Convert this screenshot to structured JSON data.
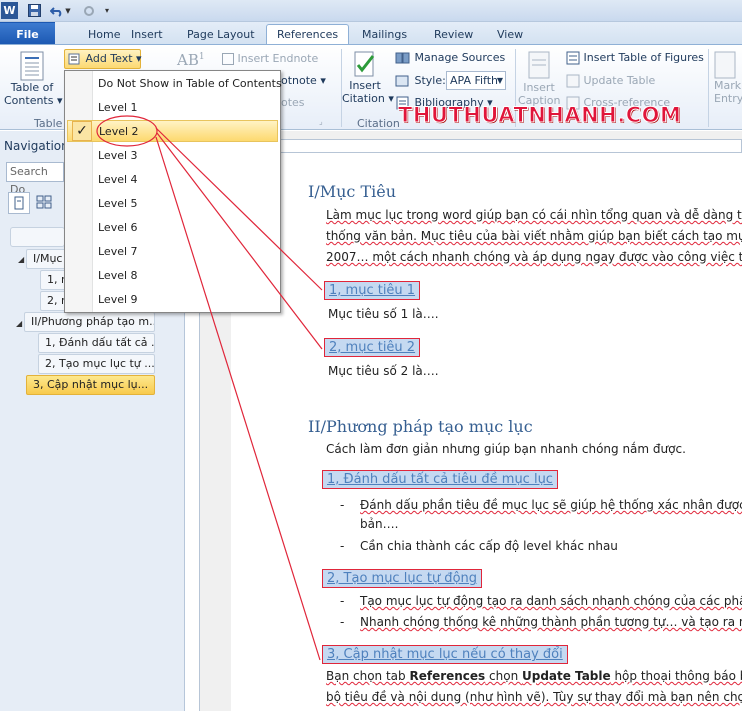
{
  "quick_access": {
    "icons": [
      "word-app-icon",
      "save-icon",
      "undo-icon",
      "redo-icon"
    ]
  },
  "tabs": [
    {
      "label": "File",
      "active": false
    },
    {
      "label": "Home",
      "active": false
    },
    {
      "label": "Insert",
      "active": false
    },
    {
      "label": "Page Layout",
      "active": false
    },
    {
      "label": "References",
      "active": true
    },
    {
      "label": "Mailings",
      "active": false
    },
    {
      "label": "Review",
      "active": false
    },
    {
      "label": "View",
      "active": false
    }
  ],
  "ribbon": {
    "toc_label_1": "Table of",
    "toc_label_2": "Contents",
    "add_text": "Add Text",
    "insert_endnote": "Insert Endnote",
    "footnote_fragment": "otnote",
    "notes_fragment": "otes",
    "insert_citation_1": "Insert",
    "insert_citation_2": "Citation",
    "manage_sources": "Manage Sources",
    "style_label": "Style:",
    "style_value": "APA Fifth",
    "bibliography": "Bibliography",
    "insert_caption_1": "Insert",
    "insert_caption_2": "Caption",
    "insert_table_of_figures": "Insert Table of Figures",
    "update_table": "Update Table",
    "cross_reference": "Cross-reference",
    "mark_entry_1": "Mark",
    "mark_entry_2": "Entry",
    "group_table": "Table",
    "group_citation": "Citation"
  },
  "dropdown": {
    "items": [
      {
        "label": "Do Not Show in Table of Contents",
        "checked": false
      },
      {
        "label": "Level 1",
        "checked": false
      },
      {
        "label": "Level 2",
        "checked": true
      },
      {
        "label": "Level 3",
        "checked": false
      },
      {
        "label": "Level 4",
        "checked": false
      },
      {
        "label": "Level 5",
        "checked": false
      },
      {
        "label": "Level 6",
        "checked": false
      },
      {
        "label": "Level 7",
        "checked": false
      },
      {
        "label": "Level 8",
        "checked": false
      },
      {
        "label": "Level 9",
        "checked": false
      }
    ],
    "check_glyph": "✓"
  },
  "navigation": {
    "title": "Navigation",
    "search_placeholder": "Search Do",
    "items": [
      {
        "label": "I/Mục T",
        "level": 1,
        "selected": false
      },
      {
        "label": "1, m",
        "level": 2,
        "selected": false
      },
      {
        "label": "2, m",
        "level": 2,
        "selected": false
      },
      {
        "label": "II/Phương pháp tạo m...",
        "level": 1,
        "selected": false
      },
      {
        "label": "1, Đánh dấu tất cả ...",
        "level": 2,
        "selected": false
      },
      {
        "label": "2, Tạo mục lục tự ...",
        "level": 2,
        "selected": false
      },
      {
        "label": "3, Cập nhật mục lụ...",
        "level": 2,
        "selected": true
      }
    ]
  },
  "watermark": "THUTHUATNHANH.COM",
  "document": {
    "h1_1": "I/Mục Tiêu",
    "p1_l1": "Làm mục lục trong word giúp bạn có cái nhìn tổng quan và dễ dàng tru",
    "p1_l2": "thống văn bản. Mục tiêu của bài viết nhằm giúp bạn biết cách tạo mục",
    "p1_l3": "2007… một cách nhanh chóng và áp dụng ngay được vào công việc thư",
    "h2_1": "1, mục tiêu  1",
    "p2": "Mục tiêu số 1 là….",
    "h2_2": "2, mục tiêu  2",
    "p3": "Mục tiêu số 2 là….",
    "h1_2": "II/Phương pháp tạo mục lục",
    "p4": "Cách làm đơn giản nhưng giúp bạn nhanh chóng nắm được.",
    "h2_3": "1, Đánh dấu tất cả tiêu đề mục lục",
    "b1_l1": "Đánh dấu phần tiêu đề mục lục sẽ giúp hệ thống xác nhân được",
    "b1_l2": "bản….",
    "b2": "Cần chia thành các cấp độ level khác nhau",
    "h2_4": "2, Tạo mục lục tự động",
    "b3": "Tạo mục lục tự động tạo ra danh sách nhanh chóng của các phần",
    "b4": "Nhanh chóng thống kê những thành phần tương tự… và tạo ra n",
    "h2_5": "3, Cập nhật mục lục nếu có thay đổi",
    "p5_a": "Bạn chọn tab ",
    "p5_b": "References",
    "p5_c": " chọn ",
    "p5_d": "Update Table",
    "p5_e": " hộp thoại thông báo ban",
    "p6": "bộ tiêu đề và nội dung (như hình vẽ). Tùy sự thay đổi mà bạn nên chọ",
    "bullet": "-"
  },
  "colors": {
    "accent_red": "#e0263a",
    "heading_blue": "#365f91",
    "selection": "#c5d9f1"
  }
}
